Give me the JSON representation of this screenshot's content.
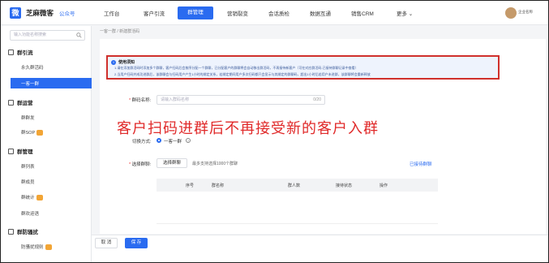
{
  "header": {
    "brand": "芝麻微客",
    "brand_tag": "公众号",
    "logo_glyph": "微",
    "nav": [
      "工作台",
      "客户引流",
      "群管理",
      "营销裂变",
      "会话质检",
      "数据互通",
      "销售CRM",
      "更多 ⌄"
    ],
    "active_index": 2,
    "user": "企业名称"
  },
  "sidebar": {
    "search_placeholder": "输入功能名称搜索",
    "groups": [
      {
        "label": "群引流",
        "items": [
          "永久群活码",
          "一客一群"
        ]
      },
      {
        "label": "群运营",
        "items": [
          "群群发",
          "群SOP"
        ]
      },
      {
        "label": "群管理",
        "items": [
          "群列表",
          "群成员",
          "群统计",
          "群欢迎语"
        ]
      },
      {
        "label": "群防骚扰",
        "items": [
          "防骚扰规则"
        ]
      }
    ]
  },
  "breadcrumb": "一客一群 / 新建群活码",
  "notice": {
    "title": "使用须知",
    "line1": "1.请在添加群活码时添加多个群聊，客户扫码后会按序分配一个群聊，已分配客户的群聊将会自动移出群活码，不再接待新客户（可在对应群活码-已接待群聊记录中查看）",
    "line2": "2.当用户扫码并成功进群后，该群聊会与扫码用户产生1小时的绑定关系，若绑定期间用户多次扫码都只会显示与其绑定的群聊码，超出1小时后若用户未进群，该群聊将会重新释放"
  },
  "form": {
    "name_label": "群码名称:",
    "name_placeholder": "请输入群码名称",
    "name_count": "0/20",
    "mode_label": "切换方式:",
    "mode_value": "一客一群",
    "select_label": "选择群聊:",
    "select_button": "选择群聊",
    "select_hint": "最多支持选择1000个群聊",
    "history_link": "已接待群聊",
    "table_headers": [
      "序号",
      "群名称",
      "群人数",
      "接待状态",
      "操作"
    ]
  },
  "overlay_text": "客户扫码进群后不再接受新的客户入群",
  "footer": {
    "cancel": "取 消",
    "save": "保 存"
  }
}
